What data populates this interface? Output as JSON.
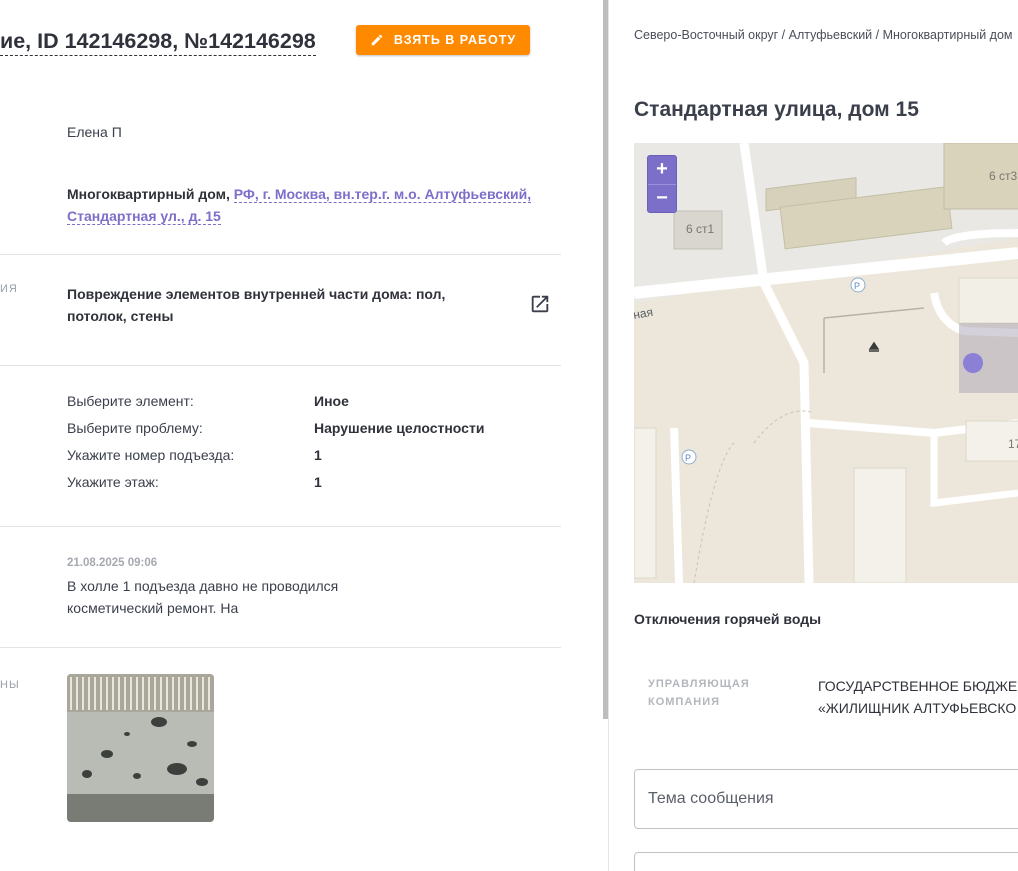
{
  "ticket": {
    "title": "ие, ID 142146298, №142146298",
    "take_button": "ВЗЯТЬ В РАБОТУ",
    "author": "Елена П",
    "object_type": "Многоквартирный дом, ",
    "address_link": "РФ, г. Москва, вн.тер.г. м.о. Алтуфьевский, Стандартная ул., д. 15",
    "category_label": "ИЯ",
    "category": "Повреждение элементов внутренней части дома: пол, потолок, стены",
    "fields": [
      {
        "key": "Выберите элемент:",
        "value": "Иное"
      },
      {
        "key": "Выберите проблему:",
        "value": "Нарушение целостности"
      },
      {
        "key": "Укажите номер подъезда:",
        "value": "1"
      },
      {
        "key": "Укажите этаж:",
        "value": "1"
      }
    ],
    "message_date": "21.08.2025 09:06",
    "message_text": "В холле 1 подъезда давно не проводился косметический ремонт. На",
    "photos_label": "НЫ"
  },
  "right": {
    "breadcrumb": "Северо-Восточный округ / Алтуфьевский / Многоквартирный дом",
    "address": "Стандартная улица, дом 15",
    "map": {
      "zoom_in": "+",
      "zoom_out": "−",
      "labels": {
        "b1": "6 ст1",
        "b2": "6 ст3",
        "b3": "17",
        "street": "ная",
        "parking": "P"
      }
    },
    "hot_water": "Отключения горячей воды",
    "management_label": "УПРАВЛЯЮЩАЯ КОМПАНИЯ",
    "management_value": "ГОСУДАРСТВЕННОЕ БЮДЖЕ\n«ЖИЛИЩНИК АЛТУФЬЕВСКО",
    "subject_placeholder": "Тема сообщения"
  },
  "colors": {
    "accent": "#ff8a00",
    "link": "#7c6fc9"
  }
}
